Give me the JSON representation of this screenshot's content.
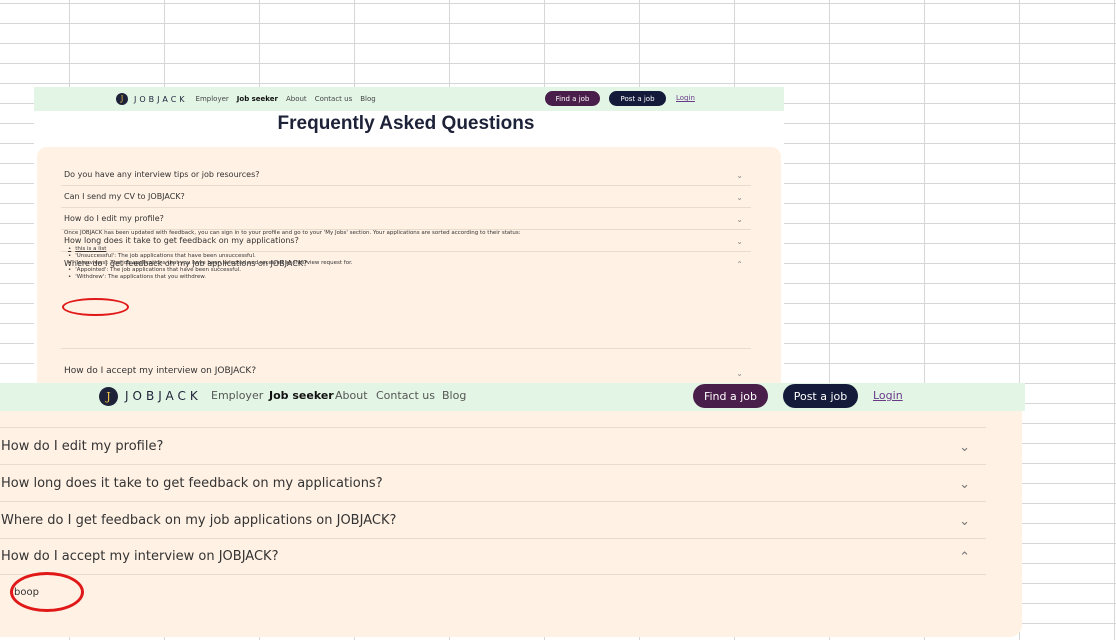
{
  "brand": {
    "logo_glyph": "J",
    "name": "JOBJACK"
  },
  "nav": {
    "employer": "Employer",
    "job_seeker": "Job seeker",
    "about": "About",
    "contact": "Contact us",
    "blog": "Blog",
    "find_job": "Find a job",
    "post_job": "Post a job",
    "login": "Login"
  },
  "top": {
    "page_title": "Frequently Asked Questions",
    "questions": [
      "Do you have any interview tips or job resources?",
      "Can I send my CV to JOBJACK?",
      "How do I edit my profile?",
      "How long does it take to get feedback on my applications?",
      "Where do I get feedback on my job applications on JOBJACK?",
      "How do I accept my interview on JOBJACK?"
    ],
    "answer_intro": "Once JOBJACK has been updated with feedback, you can sign in to your profile and go to your 'My Jobs' section. Your applications are sorted according to their status:",
    "answer_list": [
      "this is a list",
      "'Unsuccessful': The job applications that have been unsuccessful.",
      "'Interviews': The job applications that you have been selected and received an interview request for.",
      "'Appointed': The job applications that have been successful.",
      "'Withdrew': The applications that you withdrew."
    ]
  },
  "bottom": {
    "questions": [
      "How do I edit my profile?",
      "How long does it take to get feedback on my applications?",
      "Where do I get feedback on my job applications on JOBJACK?",
      "How do I accept my interview on JOBJACK?"
    ],
    "answer": "boop"
  },
  "colors": {
    "nav_bg": "#e3f6e6",
    "panel_bg": "#fff1e4",
    "find_button": "#4a1e4a",
    "post_button": "#141a3a",
    "annotation_red": "#e01818"
  },
  "icons": {
    "collapsed": "chevron-down-icon",
    "expanded": "chevron-up-icon"
  }
}
